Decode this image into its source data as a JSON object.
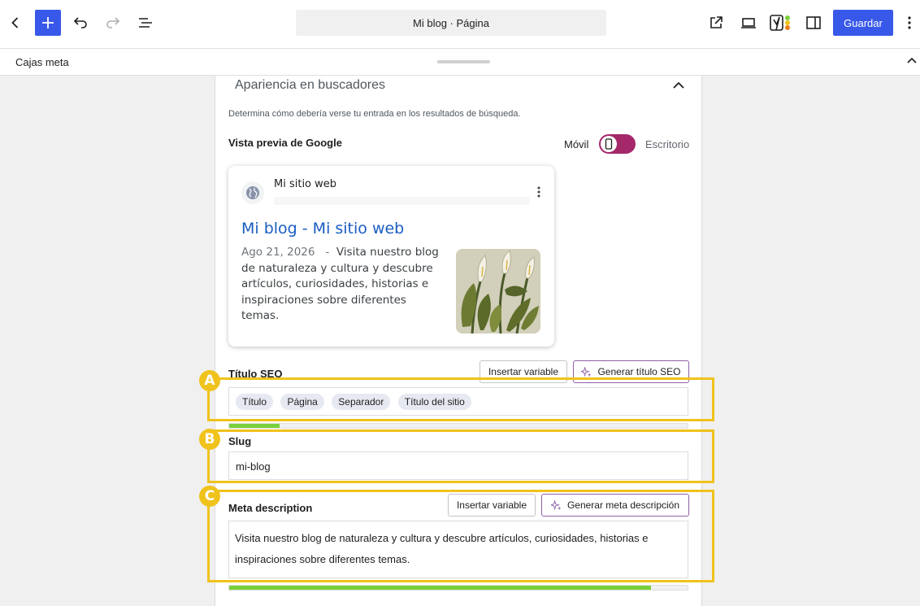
{
  "toolbar": {
    "document_title": "Mi blog · Página",
    "save_label": "Guardar",
    "accent_color": "#3858e9"
  },
  "metabox_bar": {
    "label": "Cajas meta"
  },
  "seo": {
    "section_title": "Apariencia en buscadores",
    "description": "Determina cómo debería verse tu entrada en los resultados de búsqueda.",
    "preview_label": "Vista previa de Google",
    "mode_mobile": "Móvil",
    "mode_desktop": "Escritorio",
    "toggle_color": "#a4286a",
    "preview": {
      "site_name": "Mi sitio web",
      "title": "Mi blog - Mi sitio web",
      "date": "Ago 21, 2026",
      "separator": "-",
      "snippet": "Visita nuestro blog de naturaleza y cultura y descubre artículos, curiosidades, historias e inspiraciones sobre diferentes temas."
    },
    "seo_title": {
      "label": "Título SEO",
      "insert_variable": "Insertar variable",
      "generate": "Generar título SEO",
      "chips": [
        "Título",
        "Página",
        "Separador",
        "Título del sitio"
      ],
      "progress": 0.11
    },
    "slug": {
      "label": "Slug",
      "value": "mi-blog"
    },
    "meta_description": {
      "label": "Meta description",
      "insert_variable": "Insertar variable",
      "generate": "Generar meta descripción",
      "value": "Visita nuestro blog de naturaleza y cultura y descubre artículos, curiosidades, historias e inspiraciones sobre diferentes temas.",
      "progress": 0.92
    }
  },
  "callouts": [
    "A",
    "B",
    "C"
  ],
  "callout_color": "#f0c21c"
}
